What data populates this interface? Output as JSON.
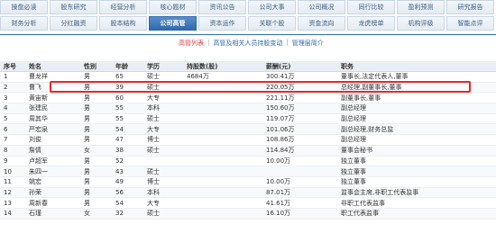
{
  "tabs_row1": [
    "操盘必读",
    "股东研究",
    "经营分析",
    "核心题材",
    "资讯公告",
    "公司大事",
    "公司概况",
    "同行比较",
    "盈利预测",
    "研究报告"
  ],
  "tabs_row2": [
    "财务分析",
    "分红融资",
    "股本结构",
    "公司高管",
    "资本运作",
    "关联个股",
    "资金流向",
    "龙虎榜单",
    "机构评级",
    "智能点评"
  ],
  "active_tab": "公司高管",
  "subtabs": {
    "current": "高管列表",
    "holding": "高管及相关人员持股变动",
    "intro": "管理层简介",
    "sep": "|"
  },
  "columns": [
    "序号",
    "姓名",
    "性别",
    "年龄",
    "学历",
    "持股数(股)",
    "薪酬(元)",
    "职务"
  ],
  "rows": [
    [
      "1",
      "曹龙祥",
      "男",
      "65",
      "硕士",
      "4684万",
      "300.41万",
      "董事长,法定代表人,董事"
    ],
    [
      "2",
      "曹飞",
      "男",
      "39",
      "硕士",
      "",
      "220.05万",
      "总经理,副董事长,董事"
    ],
    [
      "3",
      "黄宙斯",
      "男",
      "60",
      "大专",
      "",
      "221.11万",
      "副董事长,董事"
    ],
    [
      "4",
      "张建民",
      "男",
      "55",
      "本科",
      "",
      "150.60万",
      "副总经理"
    ],
    [
      "5",
      "周其华",
      "男",
      "55",
      "硕士",
      "",
      "119.07万",
      "副总经理"
    ],
    [
      "6",
      "严宏泉",
      "男",
      "54",
      "大专",
      "",
      "101.06万",
      "副总经理,财务总监"
    ],
    [
      "7",
      "刘俊",
      "男",
      "47",
      "博士",
      "",
      "108.86万",
      "副总经理"
    ],
    [
      "8",
      "詹倩",
      "女",
      "38",
      "硕士",
      "",
      "114.84万",
      "董事会秘书"
    ],
    [
      "9",
      "卢超军",
      "男",
      "52",
      "",
      "",
      "10.00万",
      "独立董事"
    ],
    [
      "10",
      "朱四一",
      "男",
      "43",
      "硕士",
      "",
      "",
      "独立董事"
    ],
    [
      "11",
      "姚宏",
      "男",
      "49",
      "博士",
      "",
      "10.00万",
      "独立董事"
    ],
    [
      "12",
      "孙荣",
      "男",
      "56",
      "本科",
      "",
      "87.01万",
      "监事会主席,非职工代表监事"
    ],
    [
      "13",
      "周新春",
      "男",
      "54",
      "大专",
      "",
      "41.61万",
      "非职工代表监事"
    ],
    [
      "14",
      "石瑾",
      "女",
      "32",
      "硕士",
      "",
      "16.10万",
      "职工代表监事"
    ]
  ]
}
